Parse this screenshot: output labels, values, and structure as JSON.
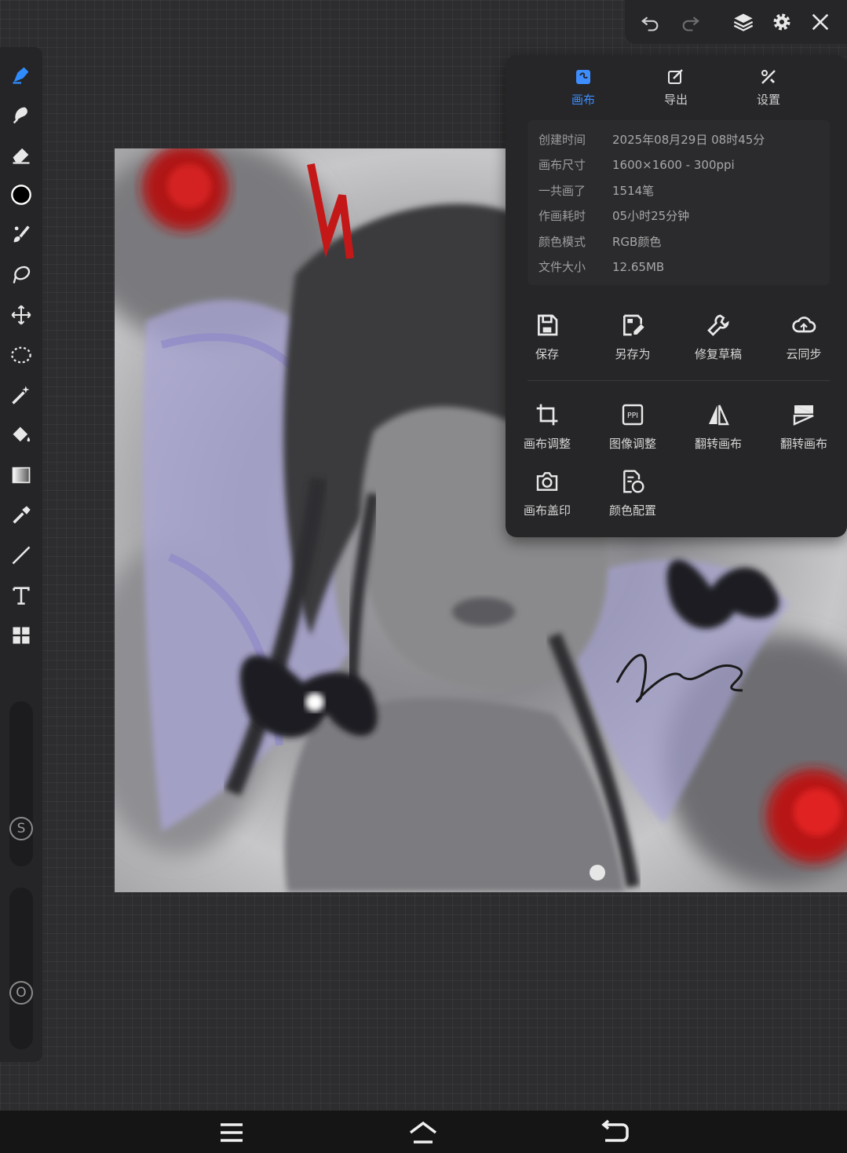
{
  "colors": {
    "accent": "#3d8dff",
    "panel": "#262628",
    "info_bg": "#2b2b2e"
  },
  "topbar": {
    "icons": [
      "undo-icon",
      "redo-icon",
      "layers-icon",
      "gear-icon",
      "close-icon"
    ]
  },
  "left_toolbar": {
    "tools": [
      "pen-icon",
      "smudge-icon",
      "eraser-icon",
      "color-picker-circle",
      "brush-icon",
      "lasso-icon",
      "transform-icon",
      "selection-icon",
      "magic-wand-icon",
      "fill-bucket-icon",
      "gradient-icon",
      "eyedropper-icon",
      "line-icon",
      "text-icon",
      "grid-icon"
    ],
    "size_slider_label": "S",
    "opacity_slider_label": "O"
  },
  "panel": {
    "tabs": [
      {
        "label": "画布",
        "icon": "canvas-icon",
        "active": true
      },
      {
        "label": "导出",
        "icon": "export-icon",
        "active": false
      },
      {
        "label": "设置",
        "icon": "tools-icon",
        "active": false
      }
    ],
    "info": [
      {
        "key": "创建时间",
        "value": "2025年08月29日 08时45分"
      },
      {
        "key": "画布尺寸",
        "value": "1600×1600 - 300ppi"
      },
      {
        "key": "一共画了",
        "value": "1514笔"
      },
      {
        "key": "作画耗时",
        "value": "05小时25分钟"
      },
      {
        "key": "颜色模式",
        "value": "RGB颜色"
      },
      {
        "key": "文件大小",
        "value": "12.65MB"
      }
    ],
    "actions_row1": [
      {
        "label": "保存",
        "icon": "save-icon"
      },
      {
        "label": "另存为",
        "icon": "save-as-icon"
      },
      {
        "label": "修复草稿",
        "icon": "wrench-icon"
      },
      {
        "label": "云同步",
        "icon": "cloud-sync-icon"
      }
    ],
    "actions_row2": [
      {
        "label": "画布调整",
        "icon": "crop-icon"
      },
      {
        "label": "图像调整",
        "icon": "ppi-icon",
        "icon_text": "PPI"
      },
      {
        "label": "翻转画布",
        "icon": "flip-horizontal-icon"
      },
      {
        "label": "翻转画布",
        "icon": "flip-vertical-icon"
      }
    ],
    "actions_row3": [
      {
        "label": "画布盖印",
        "icon": "camera-icon"
      },
      {
        "label": "颜色配置",
        "icon": "color-config-icon"
      }
    ]
  },
  "bottom_nav": {
    "icons": [
      "menu-icon",
      "home-icon",
      "back-icon"
    ]
  }
}
